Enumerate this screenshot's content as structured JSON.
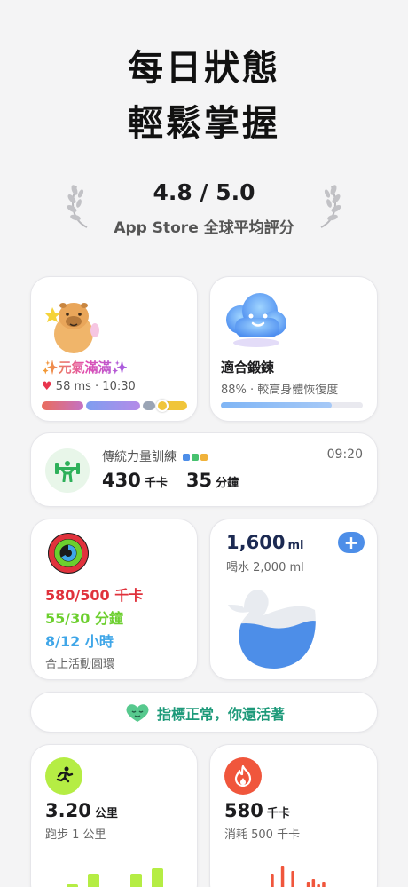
{
  "headline": {
    "line1": "每日狀態",
    "line2": "輕鬆掌握"
  },
  "rating": {
    "score": "4.8 / 5.0",
    "label": "App Store 全球平均評分"
  },
  "mood_card": {
    "label": "✨元氣滿滿✨",
    "hrv": "58 ms · 10:30",
    "bar_colors": [
      "#ea6c5c",
      "#b58be8",
      "#9aa4b5",
      "#f0c53a"
    ]
  },
  "readiness_card": {
    "label": "適合鍛鍊",
    "sub": "88% · 較高身體恢復度",
    "progress": 0.78
  },
  "training_card": {
    "title": "傳統力量訓練",
    "dot_colors": [
      "#4d8ee8",
      "#47c26f",
      "#f0b23a"
    ],
    "time": "09:20",
    "kcal_value": "430",
    "kcal_unit": "千卡",
    "duration_value": "35",
    "duration_unit": "分鐘"
  },
  "activity_card": {
    "move": "580/500 千卡",
    "exercise": "55/30 分鐘",
    "stand": "8/12 小時",
    "label": "合上活動圓環",
    "colors": {
      "move": "#e0323c",
      "exercise": "#6ccf2e",
      "stand": "#3fa6e8"
    }
  },
  "water_card": {
    "amount": "1,600",
    "unit": "ml",
    "goal": "喝水 2,000 ml",
    "plus": "+",
    "fill_level": 0.8
  },
  "status_card": {
    "text": "指標正常，你還活著"
  },
  "running_card": {
    "value": "3.20",
    "unit": "公里",
    "sub": "跑步 1 公里",
    "bars": [
      0.1,
      0.35,
      0.55,
      0.1,
      0.55,
      0.65,
      0.1
    ]
  },
  "calorie_card": {
    "value": "580",
    "unit": "千卡",
    "sub": "消耗 500 千卡",
    "bars": [
      0.05,
      0.05,
      0.05,
      0.05,
      0.05,
      0.05,
      0.05,
      0.05,
      0.05,
      0.55,
      0.3,
      0.7,
      0.25,
      0.6,
      0.05,
      0.2,
      0.4,
      0.45,
      0.35,
      0.4,
      0.25,
      0.05,
      0.15,
      0.2,
      0.05,
      0.05,
      0.05
    ]
  }
}
